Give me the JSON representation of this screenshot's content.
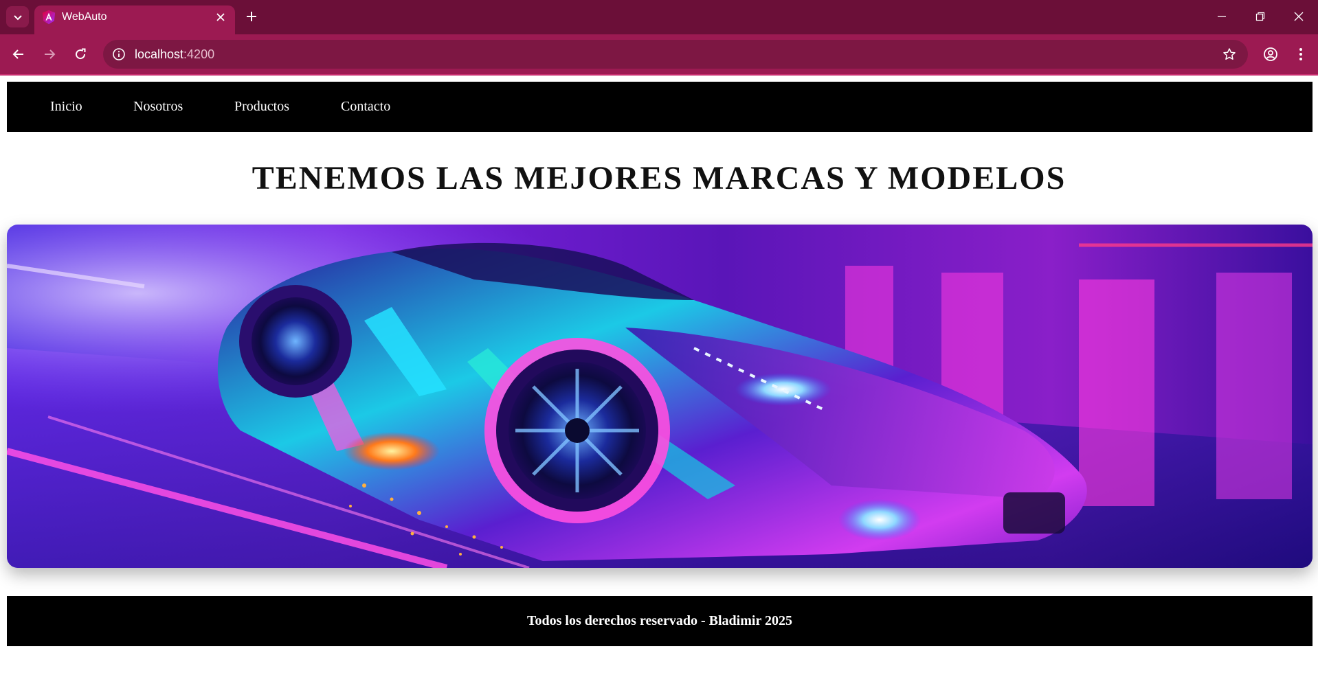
{
  "browser": {
    "tab_title": "WebAuto",
    "url_host": "localhost",
    "url_port": ":4200",
    "chrome_color": "#9c1a52"
  },
  "nav": {
    "items": [
      {
        "label": "Inicio"
      },
      {
        "label": "Nosotros"
      },
      {
        "label": "Productos"
      },
      {
        "label": "Contacto"
      }
    ]
  },
  "main": {
    "headline": "TENEMOS LAS MEJORES MARCAS Y MODELOS",
    "hero_image": "neon-sports-car"
  },
  "footer": {
    "text": "Todos los derechos reservado - Bladimir 2025"
  },
  "icons": {
    "tab_search": "chevron-down-icon",
    "favicon": "angular-logo-icon",
    "tab_close": "close-icon",
    "new_tab": "plus-icon",
    "back": "arrow-left-icon",
    "forward": "arrow-right-icon",
    "reload": "reload-icon",
    "site_info": "info-icon",
    "bookmark": "star-icon",
    "profile": "profile-icon",
    "menu": "more-vert-icon"
  }
}
